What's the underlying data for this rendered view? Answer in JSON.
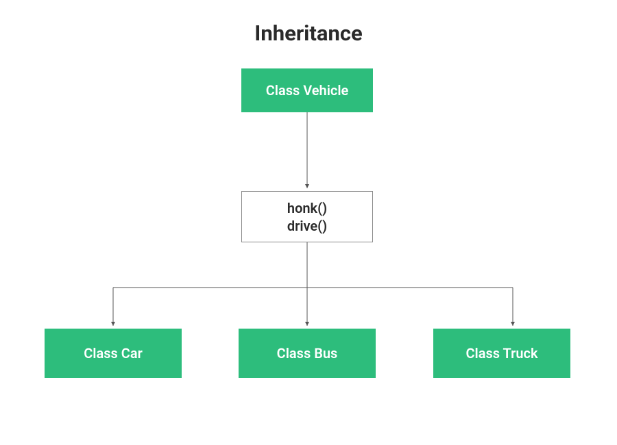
{
  "title": "Inheritance",
  "parent": {
    "label": "Class Vehicle"
  },
  "methods": {
    "line1": "honk()",
    "line2": "drive()"
  },
  "children": [
    {
      "label": "Class Car"
    },
    {
      "label": "Class Bus"
    },
    {
      "label": "Class Truck"
    }
  ],
  "colors": {
    "accent": "#2dbd7c",
    "text": "#2a2a2a"
  }
}
